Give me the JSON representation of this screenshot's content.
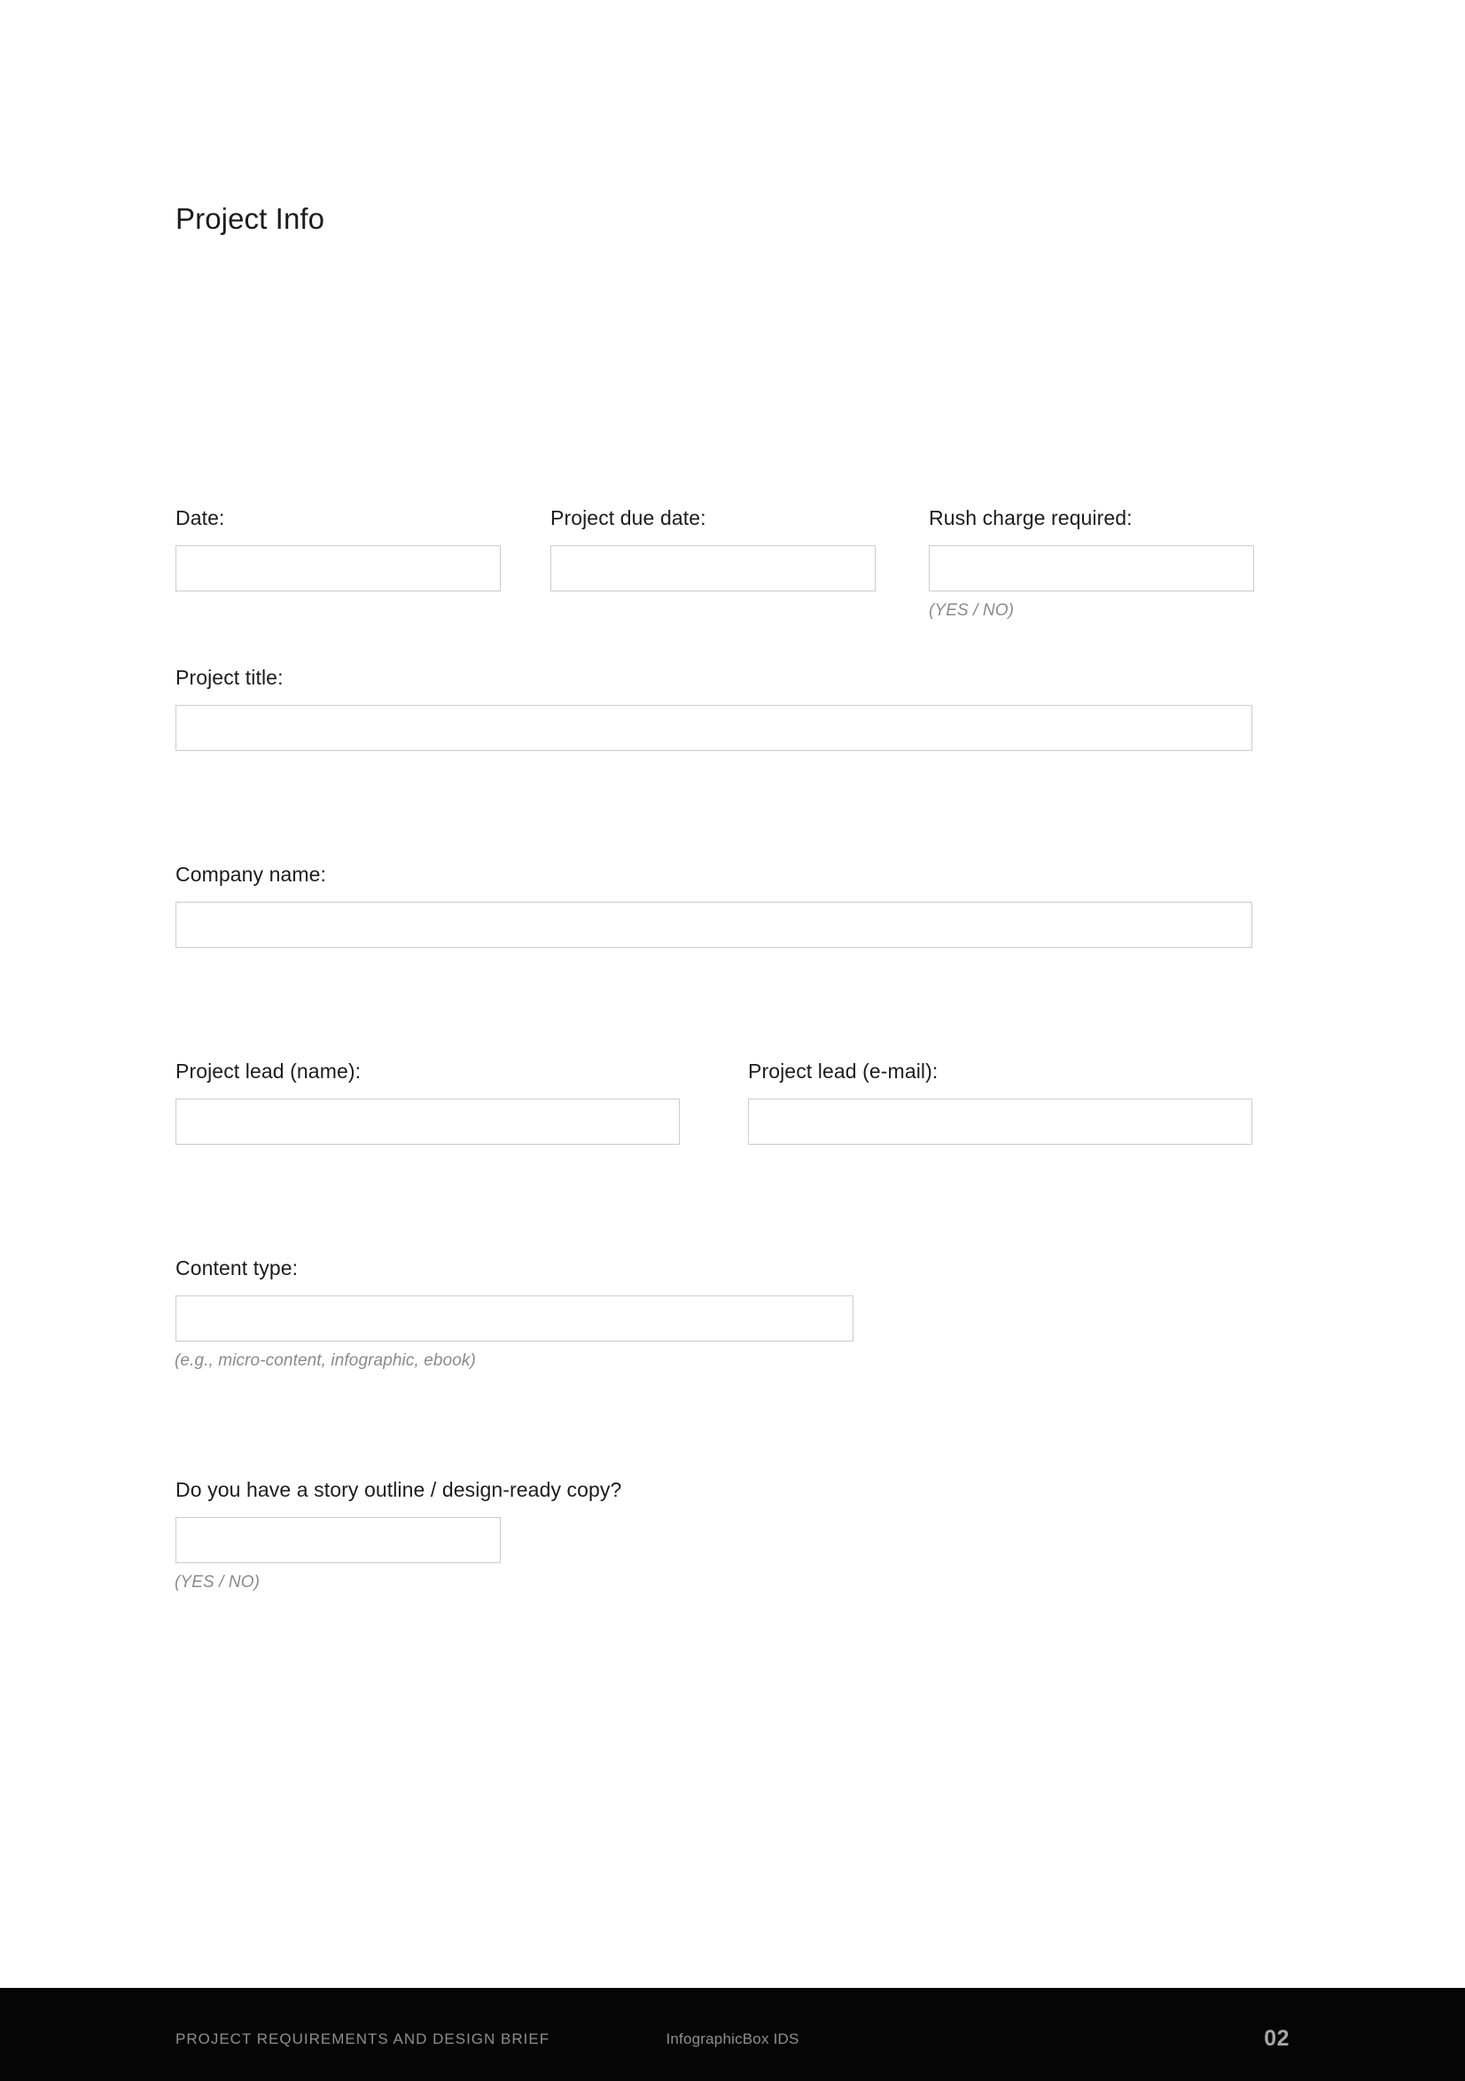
{
  "page": {
    "title": "Project Info",
    "background_color": "#ffffff",
    "text_color": "#1c1c1c",
    "box_border_color": "#cbcbcb",
    "hint_color": "#8a8a8a"
  },
  "fields": {
    "date": {
      "label": "Date:",
      "value": "",
      "placeholder": "",
      "hint": ""
    },
    "project_due_date": {
      "label": "Project due date:",
      "value": "",
      "placeholder": "",
      "hint": ""
    },
    "rush_charge_required": {
      "label": "Rush charge required:",
      "value": "",
      "placeholder": "",
      "hint": "(YES / NO)"
    },
    "project_title": {
      "label": "Project title:",
      "value": "",
      "placeholder": "",
      "hint": ""
    },
    "company_name": {
      "label": "Company name:",
      "value": "",
      "placeholder": "",
      "hint": ""
    },
    "project_lead_name": {
      "label": "Project lead (name):",
      "value": "",
      "placeholder": "",
      "hint": ""
    },
    "project_lead_email": {
      "label": "Project lead (e-mail):",
      "value": "",
      "placeholder": "",
      "hint": ""
    },
    "content_type": {
      "label": "Content type:",
      "value": "",
      "placeholder": "",
      "hint": "(e.g., micro-content, infographic, ebook)"
    },
    "story_outline": {
      "label": "Do you have a story outline / design-ready copy?",
      "value": "",
      "placeholder": "",
      "hint": "(YES / NO)"
    }
  },
  "footer": {
    "left": "PROJECT REQUIREMENTS AND DESIGN BRIEF",
    "center": "InfographicBox IDS",
    "page_number": "02",
    "background_color": "#050505",
    "text_color": "#8e8e8e",
    "page_number_color": "#a6a6a6"
  }
}
